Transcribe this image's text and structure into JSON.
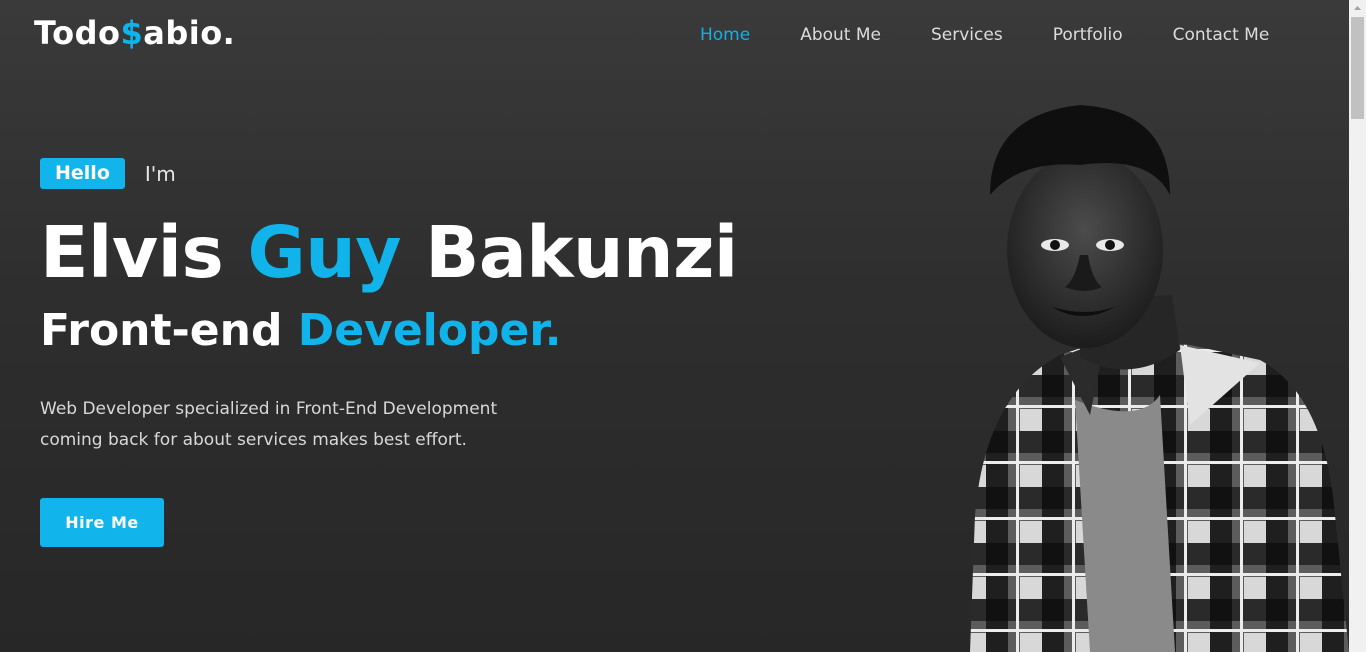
{
  "header": {
    "logo_prefix": "Todo",
    "logo_accent": "$",
    "logo_suffix": "abio."
  },
  "nav": {
    "items": [
      {
        "label": "Home",
        "active": true
      },
      {
        "label": "About Me",
        "active": false
      },
      {
        "label": "Services",
        "active": false
      },
      {
        "label": "Portfolio",
        "active": false
      },
      {
        "label": "Contact Me",
        "active": false
      }
    ]
  },
  "hero": {
    "hello_badge": "Hello",
    "intro": "I'm",
    "name_first": "Elvis",
    "name_middle": "Guy",
    "name_last": "Bakunzi",
    "role_prefix": "Front-end",
    "role_accent": "Developer.",
    "description_line1": "Web Developer specialized in Front-End Development",
    "description_line2": "coming back for about services makes best effort.",
    "cta_label": "Hire Me"
  },
  "colors": {
    "accent": "#11b4eb",
    "background": "#2e2e2e",
    "text": "#ffffff"
  }
}
